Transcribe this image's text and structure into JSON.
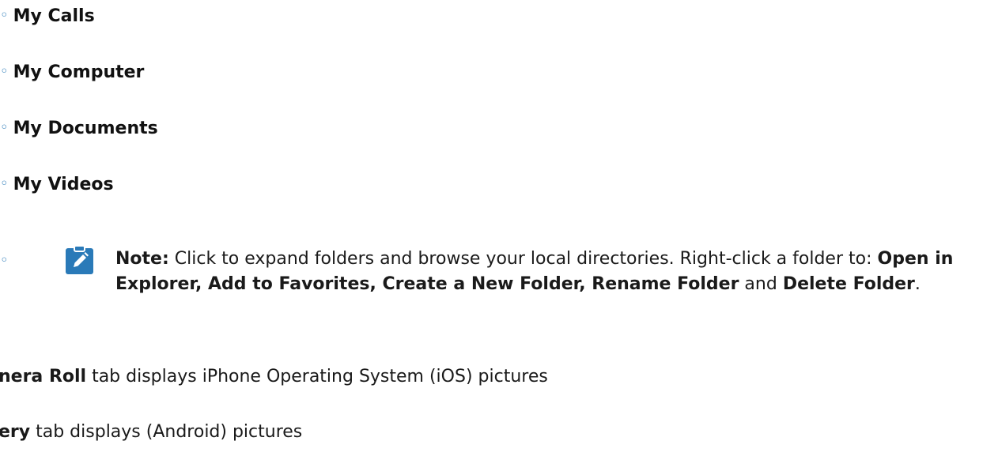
{
  "list": {
    "bullet_glyph": "◦",
    "items": [
      {
        "label": "My Calls"
      },
      {
        "label": "My Computer"
      },
      {
        "label": "My Documents"
      },
      {
        "label": "My Videos"
      }
    ]
  },
  "note": {
    "icon": "clipboard-pencil-icon",
    "icon_color": "#2a7ab8",
    "label": "Note:",
    "text_1": " Click to expand folders and browse your local directories. Right-click a folder to: ",
    "actions": "Open in Explorer, Add to Favorites, Create a New Folder, Rename Folder",
    "text_2": " and ",
    "last_action": "Delete Folder",
    "text_3": "."
  },
  "tabs": {
    "camera_roll_name": "nera Roll",
    "camera_roll_text": " tab displays iPhone Operating System (iOS) pictures",
    "gallery_name": "ery",
    "gallery_text": " tab displays (Android) pictures"
  }
}
